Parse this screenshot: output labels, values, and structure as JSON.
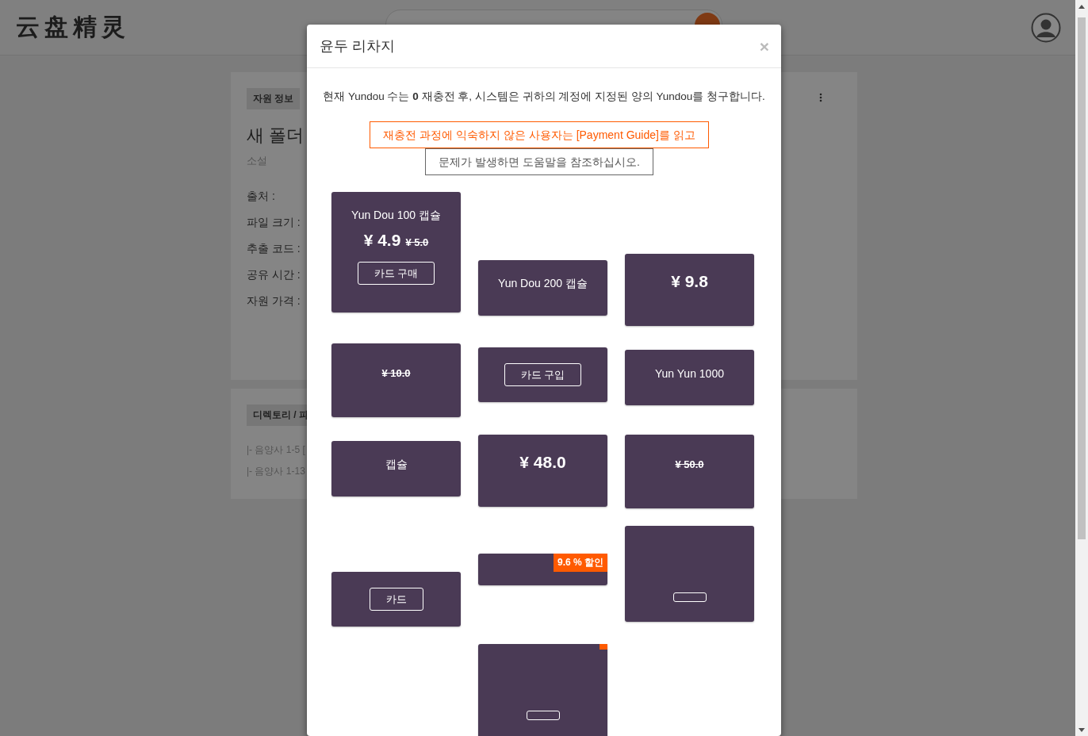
{
  "header": {
    "logo": "云盘精灵"
  },
  "resource_panel": {
    "tag": "자원 정보",
    "title": "새 폴더",
    "category": "소설",
    "fields": [
      "출처 :",
      "파일 크기 :",
      "추출 코드 :",
      "공유 시간 :",
      "자원 가격 :"
    ]
  },
  "directory_panel": {
    "tag": "디렉토리 / 파",
    "items": [
      "|- 음양사 1-5 [",
      "|- 음양사 1-13"
    ]
  },
  "modal": {
    "title": "윤두 리차지",
    "close": "×",
    "message": "현재 Yundou 수는 **0** 재충전 후, 시스템은 귀하의 계정에 지정된 양의 Yundou를 청구합니다.",
    "notice": "재충전 과정에 익숙하지 않은 사용자는 [Payment Guide]를 읽고",
    "help": "문제가 발생하면 도움말을 참조하십시오.",
    "cards": [
      {
        "items": [
          {
            "kind": "title",
            "text": "Yun Dou 100 캡슐"
          },
          {
            "kind": "price",
            "text": "¥ 4.9",
            "old": "¥ 5.0"
          },
          {
            "kind": "button",
            "label": "카드 구매"
          }
        ]
      },
      {
        "items": [
          {
            "kind": "title",
            "text": "Yun Dou 200 캡슐"
          }
        ]
      },
      {
        "items": [
          {
            "kind": "price",
            "text": "¥ 9.8"
          }
        ]
      },
      {
        "items": [
          {
            "kind": "old_price",
            "text": "¥ 10.0"
          }
        ]
      },
      {
        "items": [
          {
            "kind": "button",
            "label": "카드 구입"
          }
        ]
      },
      {
        "items": [
          {
            "kind": "title",
            "text": "Yun Yun 1000"
          }
        ]
      },
      {
        "items": [
          {
            "kind": "title",
            "text": "캡슐"
          }
        ]
      },
      {
        "items": [
          {
            "kind": "price",
            "text": "¥ 48.0"
          }
        ]
      },
      {
        "items": [
          {
            "kind": "old_price",
            "text": "¥ 50.0"
          }
        ]
      },
      {
        "items": [
          {
            "kind": "button",
            "label": "카드"
          }
        ]
      },
      {
        "items": [
          {
            "kind": "badge",
            "text": "9.6 % 할인"
          }
        ]
      },
      {
        "items": [
          {
            "kind": "button"
          }
        ]
      },
      {
        "items": [
          {
            "kind": "badge"
          },
          {
            "kind": "button"
          }
        ]
      }
    ]
  }
}
